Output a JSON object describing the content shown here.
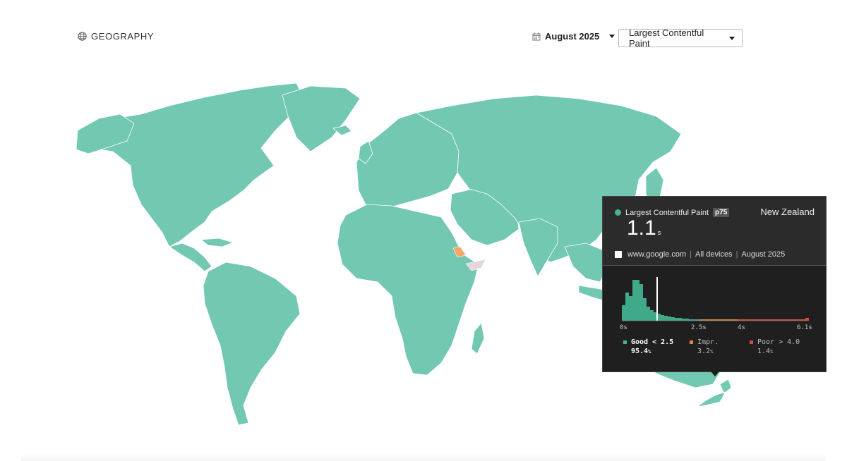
{
  "header": {
    "title": "GEOGRAPHY",
    "icon": "globe-icon"
  },
  "date_picker": {
    "value": "August 2025",
    "icon": "calendar-icon"
  },
  "metric_select": {
    "value": "Largest Contentful Paint"
  },
  "colors": {
    "good": "#72c8b0",
    "improve": "#f0a868",
    "poor": "#d04a3c",
    "no_data": "#e4d8dc"
  },
  "tooltip": {
    "metric": "Largest Contentful Paint",
    "percentile": "p75",
    "country": "New Zealand",
    "value": "1.1",
    "unit": "s",
    "origin": "www.google.com",
    "device": "All devices",
    "period": "August 2025",
    "axis_ticks": [
      "0s",
      "2.5s",
      "4s",
      "6.1s"
    ],
    "legend": [
      {
        "label": "Good < 2.5",
        "pct": "95.4",
        "pct_unit": "%"
      },
      {
        "label": "Impr.",
        "pct": "3.2",
        "pct_unit": "%"
      },
      {
        "label": "Poor > 4.0",
        "pct": "1.4",
        "pct_unit": "%"
      }
    ]
  }
}
